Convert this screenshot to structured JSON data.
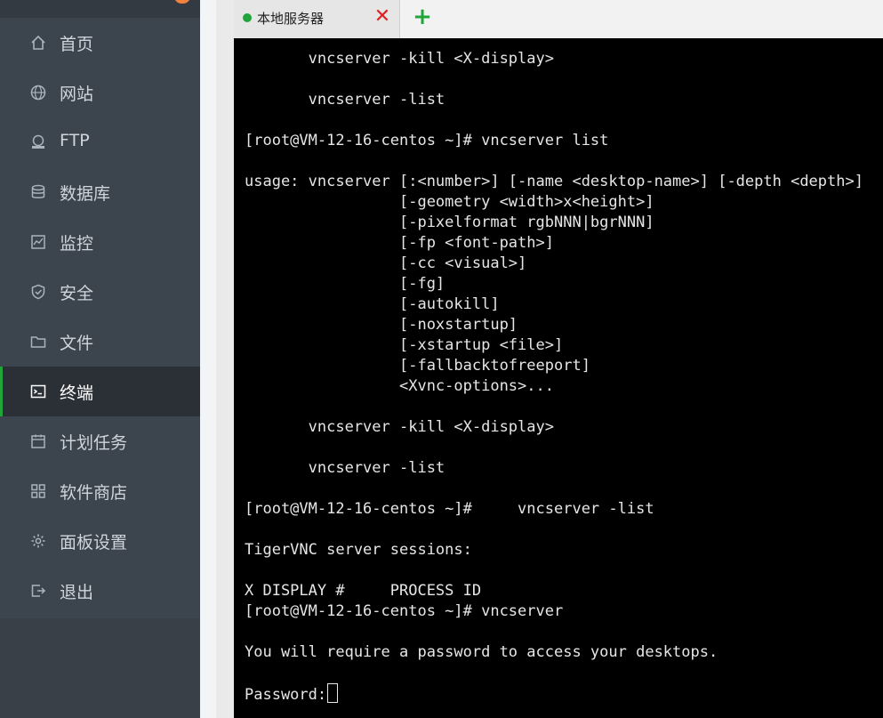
{
  "sidebar": {
    "items": [
      {
        "label": "首页",
        "icon": "home-icon"
      },
      {
        "label": "网站",
        "icon": "globe-icon"
      },
      {
        "label": "FTP",
        "icon": "ftp-icon"
      },
      {
        "label": "数据库",
        "icon": "database-icon"
      },
      {
        "label": "监控",
        "icon": "monitor-icon"
      },
      {
        "label": "安全",
        "icon": "shield-icon"
      },
      {
        "label": "文件",
        "icon": "folder-icon"
      },
      {
        "label": "终端",
        "icon": "terminal-icon",
        "active": true
      },
      {
        "label": "计划任务",
        "icon": "calendar-icon"
      },
      {
        "label": "软件商店",
        "icon": "apps-icon"
      },
      {
        "label": "面板设置",
        "icon": "gear-icon"
      },
      {
        "label": "退出",
        "icon": "logout-icon"
      }
    ]
  },
  "tabs": {
    "active_title": "本地服务器",
    "close_symbol": "✕",
    "add_symbol": "+"
  },
  "terminal": {
    "lines": [
      "       vncserver -kill <X-display>",
      "",
      "       vncserver -list",
      "",
      "[root@VM-12-16-centos ~]# vncserver list",
      "",
      "usage: vncserver [:<number>] [-name <desktop-name>] [-depth <depth>]",
      "                 [-geometry <width>x<height>]",
      "                 [-pixelformat rgbNNN|bgrNNN]",
      "                 [-fp <font-path>]",
      "                 [-cc <visual>]",
      "                 [-fg]",
      "                 [-autokill]",
      "                 [-noxstartup]",
      "                 [-xstartup <file>]",
      "                 [-fallbacktofreeport]",
      "                 <Xvnc-options>...",
      "",
      "       vncserver -kill <X-display>",
      "",
      "       vncserver -list",
      "",
      "[root@VM-12-16-centos ~]#     vncserver -list",
      "",
      "TigerVNC server sessions:",
      "",
      "X DISPLAY #     PROCESS ID",
      "[root@VM-12-16-centos ~]# vncserver",
      "",
      "You will require a password to access your desktops.",
      ""
    ],
    "prompt": "Password:"
  }
}
